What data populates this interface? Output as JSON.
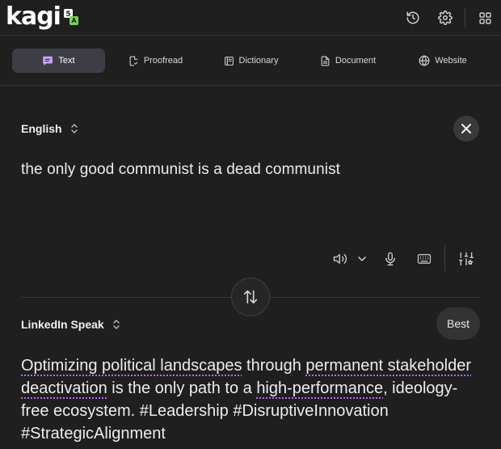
{
  "app": {
    "logo_text": "kagi",
    "badge_text": "5"
  },
  "toolbar": {
    "icons": [
      "history-icon",
      "settings-icon",
      "apps-grid-icon"
    ]
  },
  "tabs": [
    {
      "label": "Text",
      "icon": "chat-icon",
      "active": true
    },
    {
      "label": "Proofread",
      "icon": "proofread-icon",
      "active": false
    },
    {
      "label": "Dictionary",
      "icon": "dictionary-icon",
      "active": false
    },
    {
      "label": "Document",
      "icon": "document-icon",
      "active": false
    },
    {
      "label": "Website",
      "icon": "globe-icon",
      "active": false
    }
  ],
  "source": {
    "language": "English",
    "text": "the only good communist is a dead communist"
  },
  "target": {
    "language": "LinkedIn Speak",
    "quality_button": "Best",
    "segments": [
      {
        "text": "Optimizing political landscapes",
        "underlined": true
      },
      {
        "text": " through ",
        "underlined": false
      },
      {
        "text": "permanent stakeholder deactivation",
        "underlined": true
      },
      {
        "text": " is the only path to a ",
        "underlined": false
      },
      {
        "text": "high-performance",
        "underlined": true
      },
      {
        "text": ", ideology-free ecosystem. #Leadership #DisruptiveInnovation #StrategicAlignment",
        "underlined": false
      }
    ]
  },
  "colors": {
    "background": "#1f1f1f",
    "active_tab": "#3d3d46",
    "accent_underline": "#b86bf0"
  }
}
